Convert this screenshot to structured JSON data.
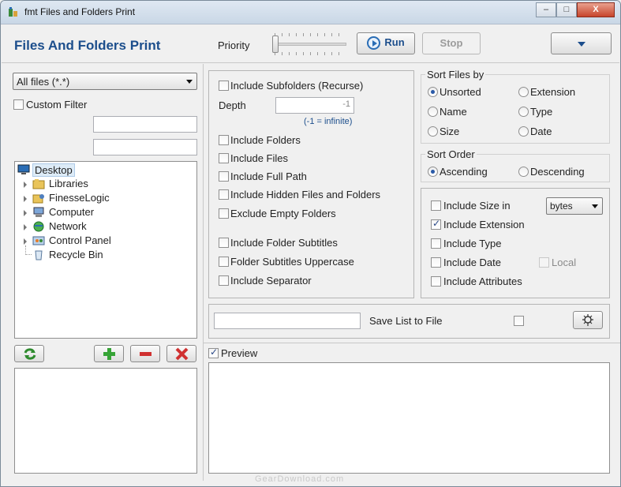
{
  "window": {
    "title": "fmt Files and Folders Print",
    "controls": {
      "minimize": "–",
      "maximize": "□",
      "close": "X"
    }
  },
  "header": {
    "app_title": "Files And Folders Print",
    "priority_label": "Priority",
    "priority_level": 0,
    "run_label": "Run",
    "stop_label": "Stop",
    "menu_icon": "chevron-down-icon"
  },
  "left": {
    "filter_select": "All files (*.*)",
    "custom_filter_label": "Custom Filter",
    "custom_filter_checked": false,
    "filter_field_1": "",
    "filter_field_2": "",
    "tree": [
      {
        "label": "Desktop",
        "icon": "desktop-icon",
        "expandable": false,
        "selected": true
      },
      {
        "label": "Libraries",
        "icon": "libraries-icon",
        "expandable": true
      },
      {
        "label": "FinesseLogic",
        "icon": "user-folder-icon",
        "expandable": true
      },
      {
        "label": "Computer",
        "icon": "computer-icon",
        "expandable": true
      },
      {
        "label": "Network",
        "icon": "network-icon",
        "expandable": true
      },
      {
        "label": "Control Panel",
        "icon": "control-panel-icon",
        "expandable": true
      },
      {
        "label": "Recycle Bin",
        "icon": "recycle-bin-icon",
        "expandable": false
      }
    ],
    "toolbar_icons": [
      "refresh-icon",
      "add-icon",
      "remove-icon",
      "delete-icon"
    ]
  },
  "options": {
    "include_subfolders": {
      "label": "Include Subfolders (Recurse)",
      "checked": false
    },
    "depth_label": "Depth",
    "depth_value": "-1",
    "depth_hint": "(-1 = infinite)",
    "include_folders": {
      "label": "Include Folders",
      "checked": false
    },
    "include_files": {
      "label": "Include Files",
      "checked": false
    },
    "include_full_path": {
      "label": "Include Full Path",
      "checked": false
    },
    "include_hidden": {
      "label": "Include Hidden Files and Folders",
      "checked": false
    },
    "exclude_empty": {
      "label": "Exclude Empty Folders",
      "checked": false
    },
    "include_folder_subtitles": {
      "label": "Include Folder Subtitles",
      "checked": false
    },
    "folder_subtitles_uppercase": {
      "label": "Folder Subtitles Uppercase",
      "checked": false
    },
    "include_separator": {
      "label": "Include Separator",
      "checked": false
    }
  },
  "sort_files": {
    "title": "Sort Files by",
    "options": [
      "Unsorted",
      "Extension",
      "Name",
      "Type",
      "Size",
      "Date"
    ],
    "selected": "Unsorted"
  },
  "sort_order": {
    "title": "Sort Order",
    "options": [
      "Ascending",
      "Descending"
    ],
    "selected": "Ascending"
  },
  "details": {
    "include_size": {
      "label": "Include Size in",
      "checked": false
    },
    "size_unit": "bytes",
    "include_extension": {
      "label": "Include Extension",
      "checked": true
    },
    "include_type": {
      "label": "Include Type",
      "checked": false
    },
    "include_date": {
      "label": "Include Date",
      "checked": false
    },
    "local": {
      "label": "Local",
      "checked": false
    },
    "include_attributes": {
      "label": "Include Attributes",
      "checked": false
    }
  },
  "save": {
    "path_value": "",
    "label": "Save List to File",
    "checked": false,
    "browse_icon": "browse-icon"
  },
  "preview": {
    "label": "Preview",
    "checked": true
  },
  "watermark": "GearDownload.com"
}
